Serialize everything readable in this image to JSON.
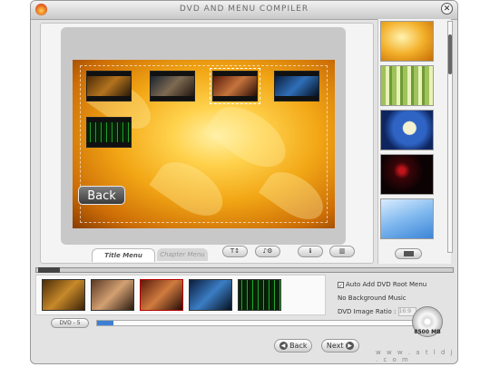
{
  "window": {
    "title": "DVD AND MENU COMPILER",
    "close_glyph": "✕"
  },
  "menu_preview": {
    "back_label": "Back"
  },
  "tabs": [
    {
      "label": "Title Menu",
      "active": true
    },
    {
      "label": "Chapter Menu",
      "active": false
    }
  ],
  "options": {
    "auto_add_root_menu": {
      "label": "Auto Add DVD Root Menu",
      "checked": true
    },
    "background_music": "No Background Music",
    "image_ratio_label": "DVD Image Ratio :",
    "image_ratio_value": "16:9"
  },
  "disc": {
    "type_label": "DVD - 5",
    "capacity_label": "8500 MB",
    "used_fraction": 0.05
  },
  "nav": {
    "back_label": "Back",
    "next_label": "Next",
    "back_glyph": "◀",
    "next_glyph": "▶"
  },
  "watermark": "w w w . a t l d j . c o m",
  "colors": {
    "accent": "#3d7fd6",
    "window_bg": "#e3e3e3"
  }
}
